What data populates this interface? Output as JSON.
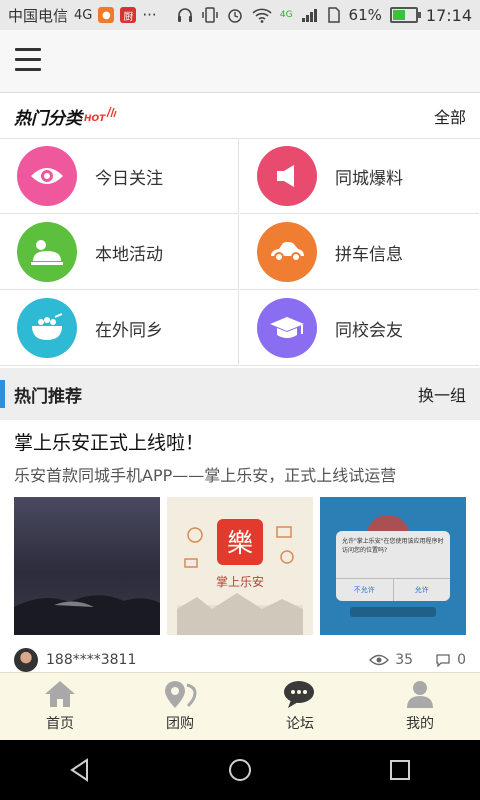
{
  "status_bar": {
    "carrier": "中国电信",
    "network": "4G",
    "dots": "···",
    "net_badge": "4G",
    "battery_percent": "61%",
    "battery_level": 0.61,
    "time": "17:14"
  },
  "categories": {
    "title": "热门分类",
    "badge": "HOT",
    "all_label": "全部",
    "items": [
      {
        "label": "今日关注",
        "color": "#f0589e",
        "icon": "eye-icon"
      },
      {
        "label": "同城爆料",
        "color": "#e94b6e",
        "icon": "megaphone-icon"
      },
      {
        "label": "本地活动",
        "color": "#5cbf3e",
        "icon": "activity-icon"
      },
      {
        "label": "拼车信息",
        "color": "#ef7e33",
        "icon": "car-icon"
      },
      {
        "label": "在外同乡",
        "color": "#2eb9d4",
        "icon": "bowl-icon"
      },
      {
        "label": "同校会友",
        "color": "#8a6df0",
        "icon": "graduation-cap-icon"
      }
    ]
  },
  "recommend": {
    "title": "热门推荐",
    "switch_label": "换一组",
    "post": {
      "title": "掌上乐安正式上线啦！",
      "desc": "乐安首款同城手机APP——掌上乐安，正式上线试运营",
      "app_name": "掌上乐安",
      "dialog_text": "允许\"掌上乐安\"在您使用该应用程序时访问您的位置吗?",
      "dialog_cancel": "不允许",
      "dialog_ok": "允许",
      "user": "188****3811",
      "views": "35",
      "comments": "0"
    }
  },
  "tabs": [
    {
      "label": "首页",
      "icon": "home-icon"
    },
    {
      "label": "团购",
      "icon": "location-pin-icon"
    },
    {
      "label": "论坛",
      "icon": "chat-icon"
    },
    {
      "label": "我的",
      "icon": "user-icon"
    }
  ]
}
